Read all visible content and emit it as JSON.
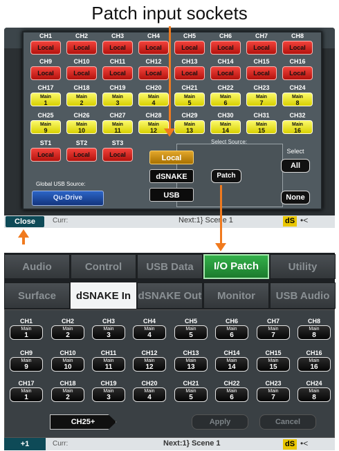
{
  "caption": "Patch input sockets",
  "top": {
    "channels_row1": [
      {
        "label": "CH1",
        "value": "Local"
      },
      {
        "label": "CH2",
        "value": "Local"
      },
      {
        "label": "CH3",
        "value": "Local"
      },
      {
        "label": "CH4",
        "value": "Local"
      },
      {
        "label": "CH5",
        "value": "Local"
      },
      {
        "label": "CH6",
        "value": "Local"
      },
      {
        "label": "CH7",
        "value": "Local"
      },
      {
        "label": "CH8",
        "value": "Local"
      }
    ],
    "channels_row2": [
      {
        "label": "CH9",
        "value": "Local"
      },
      {
        "label": "CH10",
        "value": "Local"
      },
      {
        "label": "CH11",
        "value": "Local"
      },
      {
        "label": "CH12",
        "value": "Local"
      },
      {
        "label": "CH13",
        "value": "Local"
      },
      {
        "label": "CH14",
        "value": "Local"
      },
      {
        "label": "CH15",
        "value": "Local"
      },
      {
        "label": "CH16",
        "value": "Local"
      }
    ],
    "channels_row3": [
      {
        "label": "CH17",
        "m": "Main",
        "n": "1"
      },
      {
        "label": "CH18",
        "m": "Main",
        "n": "2"
      },
      {
        "label": "CH19",
        "m": "Main",
        "n": "3"
      },
      {
        "label": "CH20",
        "m": "Main",
        "n": "4"
      },
      {
        "label": "CH21",
        "m": "Main",
        "n": "5"
      },
      {
        "label": "CH22",
        "m": "Main",
        "n": "6"
      },
      {
        "label": "CH23",
        "m": "Main",
        "n": "7"
      },
      {
        "label": "CH24",
        "m": "Main",
        "n": "8"
      }
    ],
    "channels_row4": [
      {
        "label": "CH25",
        "m": "Main",
        "n": "9"
      },
      {
        "label": "CH26",
        "m": "Main",
        "n": "10"
      },
      {
        "label": "CH27",
        "m": "Main",
        "n": "11"
      },
      {
        "label": "CH28",
        "m": "Main",
        "n": "12"
      },
      {
        "label": "CH29",
        "m": "Main",
        "n": "13"
      },
      {
        "label": "CH30",
        "m": "Main",
        "n": "14"
      },
      {
        "label": "CH31",
        "m": "Main",
        "n": "15"
      },
      {
        "label": "CH32",
        "m": "Main",
        "n": "16"
      }
    ],
    "stereo": [
      {
        "label": "ST1",
        "value": "Local"
      },
      {
        "label": "ST2",
        "value": "Local"
      },
      {
        "label": "ST3",
        "value": "Local"
      }
    ],
    "select_source_title": "Select Source:",
    "source_local": "Local",
    "source_dsnake": "dSNAKE",
    "source_usb": "USB",
    "patch": "Patch",
    "select_label": "Select",
    "all": "All",
    "none": "None",
    "global_usb_label": "Global USB Source:",
    "global_usb_value": "Qu-Drive",
    "close": "Close",
    "curr": "Curr:",
    "next": "Next:1} Scene 1",
    "ds": "dS",
    "usb_symbol": "•<"
  },
  "bottom": {
    "tabs": [
      "Audio",
      "Control",
      "USB Data",
      "I/O Patch",
      "Utility"
    ],
    "subtabs": [
      "Surface",
      "dSNAKE In",
      "dSNAKE Out",
      "Monitor",
      "USB Audio"
    ],
    "rows": [
      [
        {
          "label": "CH1",
          "n": "1"
        },
        {
          "label": "CH2",
          "n": "2"
        },
        {
          "label": "CH3",
          "n": "3"
        },
        {
          "label": "CH4",
          "n": "4"
        },
        {
          "label": "CH5",
          "n": "5"
        },
        {
          "label": "CH6",
          "n": "6"
        },
        {
          "label": "CH7",
          "n": "7"
        },
        {
          "label": "CH8",
          "n": "8"
        }
      ],
      [
        {
          "label": "CH9",
          "n": "9"
        },
        {
          "label": "CH10",
          "n": "10"
        },
        {
          "label": "CH11",
          "n": "11"
        },
        {
          "label": "CH12",
          "n": "12"
        },
        {
          "label": "CH13",
          "n": "13"
        },
        {
          "label": "CH14",
          "n": "14"
        },
        {
          "label": "CH15",
          "n": "15"
        },
        {
          "label": "CH16",
          "n": "16"
        }
      ],
      [
        {
          "label": "CH17",
          "n": "1"
        },
        {
          "label": "CH18",
          "n": "2"
        },
        {
          "label": "CH19",
          "n": "3"
        },
        {
          "label": "CH20",
          "n": "4"
        },
        {
          "label": "CH21",
          "n": "5"
        },
        {
          "label": "CH22",
          "n": "6"
        },
        {
          "label": "CH23",
          "n": "7"
        },
        {
          "label": "CH24",
          "n": "8"
        }
      ]
    ],
    "main_label": "Main",
    "ch25": "CH25+",
    "apply": "Apply",
    "cancel": "Cancel",
    "plus_one": "+1",
    "curr": "Curr:",
    "next": "Next:1} Scene 1",
    "ds": "dS",
    "usb_symbol": "•<"
  },
  "colors": {
    "arrow": "#f07a1e",
    "red_chip": "#d62a22",
    "yellow_chip": "#eeea20",
    "active_tab": "#2ea344",
    "selected_source": "#c88a10",
    "usb_source": "#1f4ea6"
  }
}
